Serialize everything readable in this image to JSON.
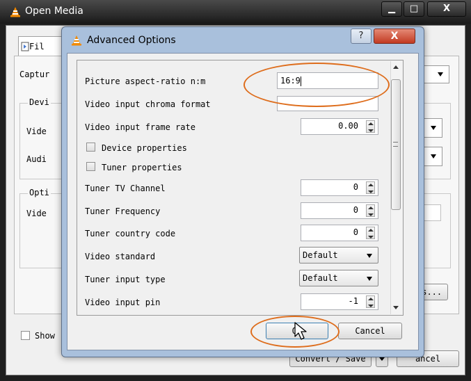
{
  "outer": {
    "title": "Open Media",
    "minimize_icon": "minimize-icon",
    "maximize_icon": "maximize-icon",
    "close_label": "X",
    "tab_file": "Fil",
    "capture_label": "Captur",
    "device_group": "Devi",
    "video_label": "Vide",
    "audio_label": "Audi",
    "options_group": "Opti",
    "video_label_2": "Vide",
    "options_button": "ns...",
    "show_label": "Show",
    "convert_button": "Convert / Save",
    "cancel_button": "ancel"
  },
  "dialog": {
    "title": "Advanced Options",
    "help_label": "?",
    "close_label": "X",
    "fields": {
      "aspect_ratio_label": "Picture aspect-ratio n:m",
      "aspect_ratio_value": "16:9",
      "chroma_label": "Video input chroma format",
      "chroma_value": "",
      "frame_rate_label": "Video input frame rate",
      "frame_rate_value": "0.00",
      "device_props_label": "Device properties",
      "tuner_props_label": "Tuner properties",
      "tv_channel_label": "Tuner TV Channel",
      "tv_channel_value": "0",
      "frequency_label": "Tuner Frequency",
      "frequency_value": "0",
      "country_label": "Tuner country code",
      "country_value": "0",
      "standard_label": "Video standard",
      "standard_value": "Default",
      "input_type_label": "Tuner input type",
      "input_type_value": "Default",
      "input_pin_label": "Video input pin",
      "input_pin_value": "-1"
    },
    "ok_label": "OK",
    "cancel_label": "Cancel"
  },
  "colors": {
    "annotation": "#de6d1c",
    "dialog_frame": "#a9c0dc",
    "dark_frame": "#1f1f1f"
  }
}
